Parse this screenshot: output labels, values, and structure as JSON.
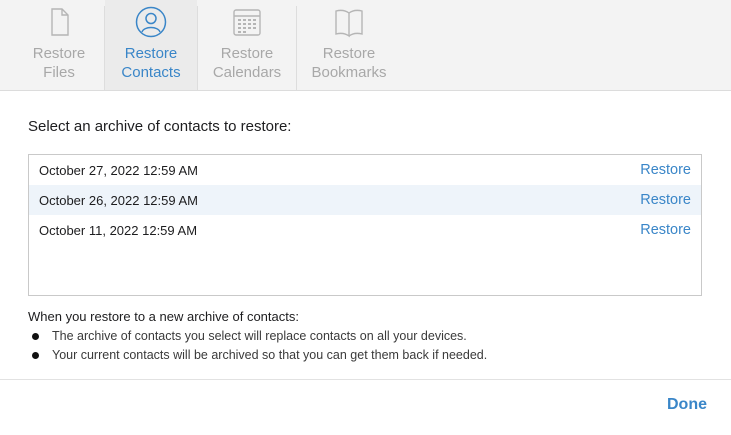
{
  "tabs": [
    {
      "line1": "Restore",
      "line2": "Files",
      "icon": "document-icon",
      "active": false
    },
    {
      "line1": "Restore",
      "line2": "Contacts",
      "icon": "contacts-icon",
      "active": true
    },
    {
      "line1": "Restore",
      "line2": "Calendars",
      "icon": "calendar-icon",
      "active": false
    },
    {
      "line1": "Restore",
      "line2": "Bookmarks",
      "icon": "book-icon",
      "active": false
    }
  ],
  "main": {
    "title": "Select an archive of contacts to restore:",
    "archives": [
      {
        "date": "October 27, 2022 12:59 AM",
        "action": "Restore"
      },
      {
        "date": "October 26, 2022 12:59 AM",
        "action": "Restore"
      },
      {
        "date": "October 11, 2022 12:59 AM",
        "action": "Restore"
      }
    ],
    "info_heading": "When you restore to a new archive of contacts:",
    "bullets": [
      "The archive of contacts you select will replace contacts on all your devices.",
      "Your current contacts will be archived so that you can get them back if needed."
    ]
  },
  "footer": {
    "done_label": "Done"
  },
  "colors": {
    "accent": "#3a86c8",
    "inactive_tab": "#a8a8a8",
    "alt_row": "#eef4fa"
  }
}
